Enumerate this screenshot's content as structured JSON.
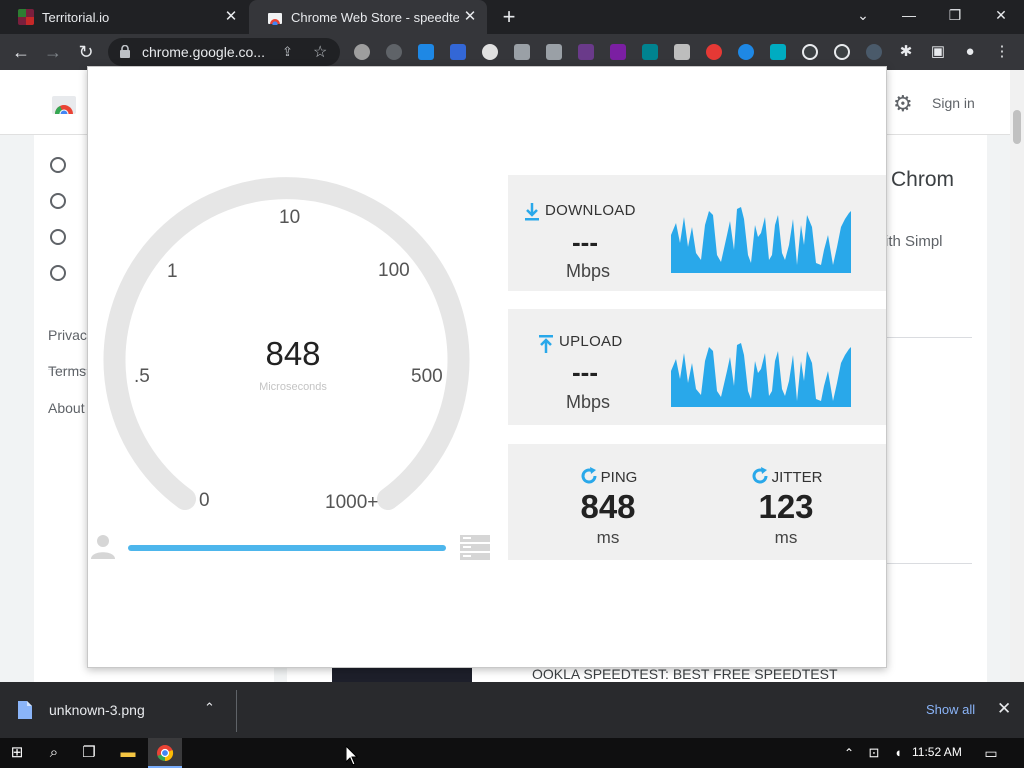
{
  "browser": {
    "tabs": [
      {
        "title": "Territorial.io",
        "active": false
      },
      {
        "title": "Chrome Web Store - speedtest",
        "active": true
      }
    ],
    "new_tab": "+",
    "url": "chrome.google.co...",
    "window_controls": {
      "minimize": "—",
      "restore": "❐",
      "close": "✕",
      "tab_list": "⌄"
    }
  },
  "store_page": {
    "sign_in": "Sign in",
    "sidebar_links": [
      "Privac",
      "Terms",
      "About"
    ],
    "partial_heading": "Chrom",
    "partial_text": "ith Simpl",
    "listing_title": "OOKLA SPEEDTEST: BEST FREE SPEEDTEST"
  },
  "speedtest": {
    "gauge": {
      "value": "848",
      "unit": "Microseconds",
      "ticks": [
        "0",
        ".5",
        "1",
        "10",
        "100",
        "500",
        "1000+"
      ],
      "progress": 1.0
    },
    "download": {
      "label": "DOWNLOAD",
      "value": "---",
      "unit": "Mbps"
    },
    "upload": {
      "label": "UPLOAD",
      "value": "---",
      "unit": "Mbps"
    },
    "ping": {
      "label": "PING",
      "value": "848",
      "unit": "ms"
    },
    "jitter": {
      "label": "JITTER",
      "value": "123",
      "unit": "ms"
    },
    "accent_color": "#29a8ea"
  },
  "download_shelf": {
    "file_name": "unknown-3.png",
    "show_all": "Show all"
  },
  "taskbar": {
    "clock": "11:52 AM"
  }
}
